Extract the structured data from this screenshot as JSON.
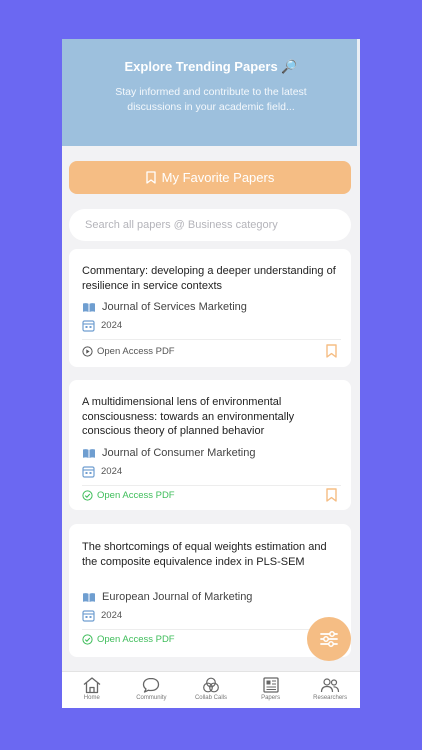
{
  "header": {
    "title": "Explore Trending Papers",
    "title_icon": "magnifier-emoji",
    "subtitle": "Stay informed and contribute to the latest discussions in your academic field..."
  },
  "favorites_button": {
    "label": "My Favorite Papers",
    "icon": "bookmark-icon"
  },
  "search": {
    "placeholder": "Search all papers @ Business category",
    "value": ""
  },
  "papers": [
    {
      "title": "Commentary: developing a deeper understanding of resilience in service contexts",
      "journal": "Journal of Services Marketing",
      "year": "2024",
      "access": "Open Access PDF",
      "access_status": "neutral"
    },
    {
      "title": "A multidimensional lens of environmental consciousness: towards an environmentally conscious theory of planned behavior",
      "journal": "Journal of Consumer Marketing",
      "year": "2024",
      "access": "Open Access PDF",
      "access_status": "available"
    },
    {
      "title": "The shortcomings of equal weights estimation and the composite equivalence index in PLS-SEM",
      "journal": "European Journal of Marketing",
      "year": "2024",
      "access": "Open Access PDF",
      "access_status": "available"
    }
  ],
  "tabs": [
    {
      "label": "Home",
      "icon": "home-icon"
    },
    {
      "label": "Community",
      "icon": "chat-icon"
    },
    {
      "label": "Collab Calls",
      "icon": "collab-icon"
    },
    {
      "label": "Papers",
      "icon": "newspaper-icon"
    },
    {
      "label": "Researchers",
      "icon": "people-icon"
    }
  ],
  "colors": {
    "background": "#6b68f2",
    "header": "#9dc0dd",
    "accent": "#f5bd84",
    "green": "#3ebd5a",
    "journal_icon": "#6f9ed0"
  }
}
